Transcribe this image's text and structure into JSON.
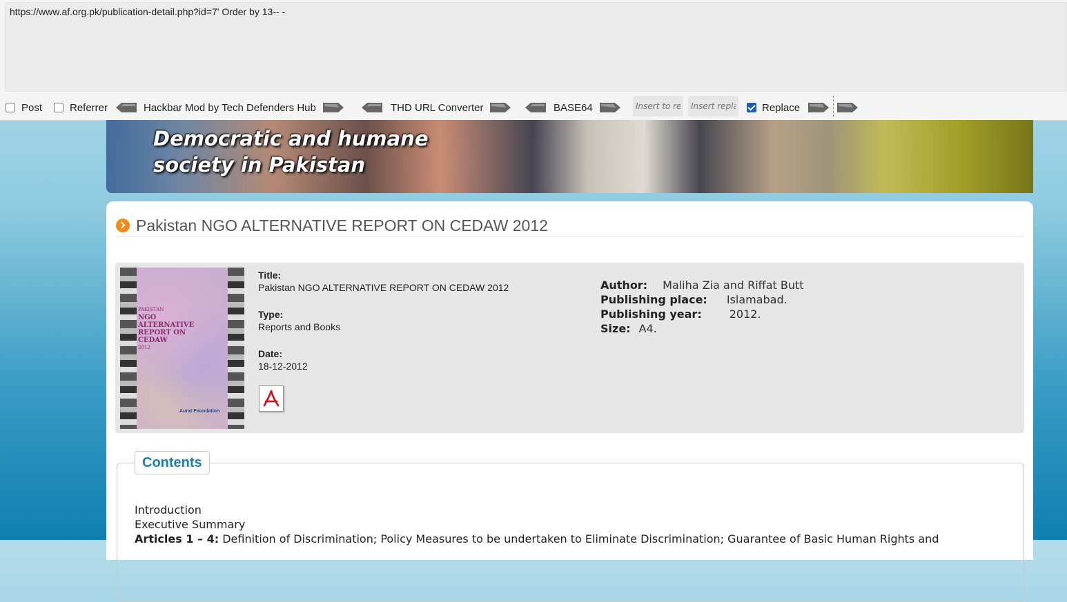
{
  "hackbar": {
    "url": "https://www.af.org.pk/publication-detail.php?id=7' Order by 13-- -",
    "post_label": "Post",
    "referrer_label": "Referrer",
    "hackbar_mod_label": "Hackbar Mod by Tech Defenders Hub",
    "url_converter_label": "THD URL Converter",
    "base64_label": "BASE64",
    "insert_to_replace_placeholder": "Insert to rep",
    "insert_replacement_placeholder": "Insert replac",
    "replace_label": "Replace",
    "replace_checked": true
  },
  "banner": {
    "title": "Democratic and humane\nsociety in Pakistan"
  },
  "publication": {
    "heading": "Pakistan NGO ALTERNATIVE REPORT ON CEDAW 2012",
    "title_label": "Title:",
    "title": "Pakistan NGO ALTERNATIVE REPORT ON CEDAW 2012",
    "type_label": "Type:",
    "type": "Reports and Books",
    "date_label": "Date:",
    "date": "18-12-2012",
    "author_label": "Author:",
    "author": "Maliha Zia and Riffat Butt",
    "place_label": "Publishing place:",
    "place": "Islamabad.",
    "year_label": "Publishing year:",
    "year": "2012.",
    "size_label": "Size:",
    "size": "A4.",
    "cover": {
      "small": "PAKISTAN",
      "line1": "NGO ALTERNATIVE",
      "line2": "REPORT ON",
      "line3": "CEDAW",
      "line4": "2012",
      "publisher": "Aurat Foundation"
    }
  },
  "contents": {
    "legend": "Contents",
    "items": [
      "Introduction",
      "Executive Summary"
    ],
    "articles_label": "Articles 1 – 4:",
    "articles_text": "Definition of Discrimination; Policy Measures to be undertaken to Eliminate Discrimination; Guarantee of Basic Human Rights and"
  },
  "colors": {
    "accent_orange": "#f28a1c",
    "contents_blue": "#1c7fb1",
    "checkbox_blue": "#1a5fb4"
  }
}
